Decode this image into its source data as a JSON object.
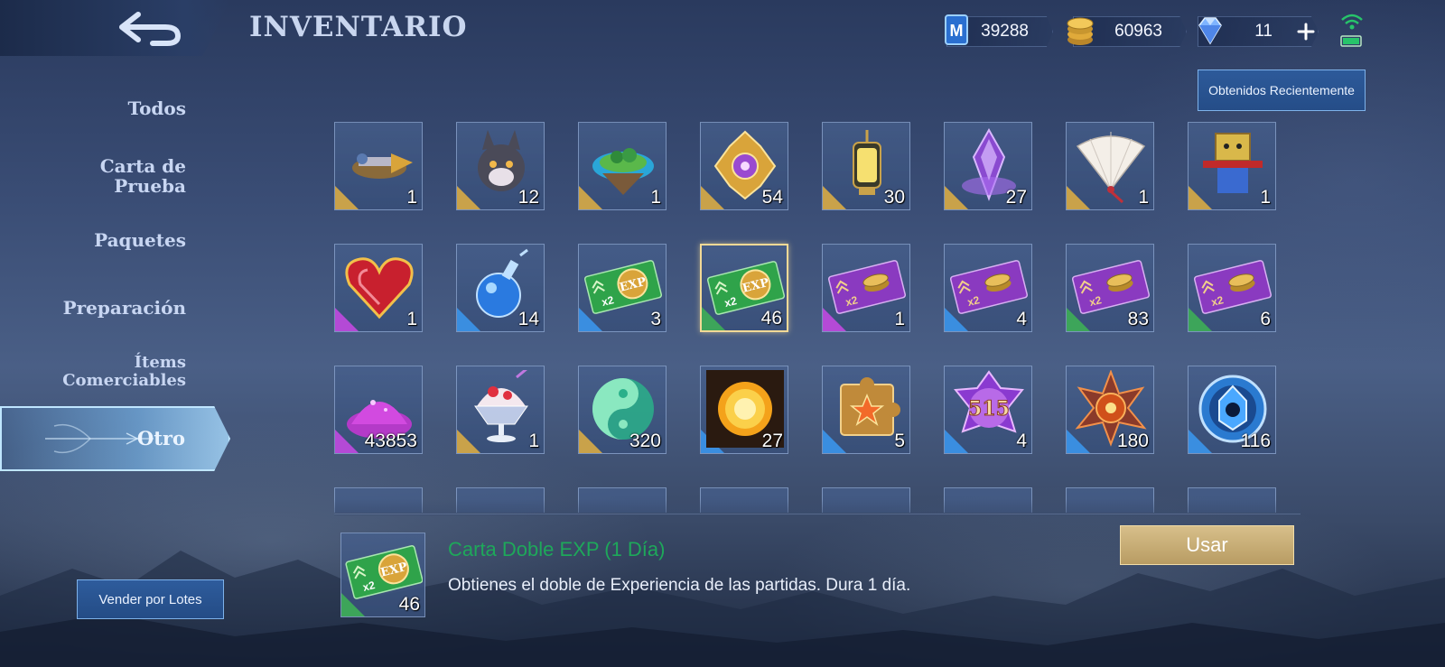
{
  "header": {
    "title": "INVENTARIO",
    "back_icon": "back-arrow-icon"
  },
  "currencies": [
    {
      "name": "battle-points",
      "icon": "bp-card-icon",
      "value": "39288"
    },
    {
      "name": "tickets",
      "icon": "gold-coins-icon",
      "value": "60963"
    },
    {
      "name": "diamonds",
      "icon": "diamond-icon",
      "value": "11",
      "add_icon": "plus-icon"
    }
  ],
  "status": {
    "signal_icon": "wifi-signal-icon",
    "battery_icon": "battery-icon"
  },
  "recent_button": "Obtenidos Recientemente",
  "sidebar": {
    "items": [
      {
        "label": "Todos"
      },
      {
        "label": "Carta de Prueba"
      },
      {
        "label": "Paquetes"
      },
      {
        "label": "Preparación"
      },
      {
        "label": "Ítems Comerciables"
      },
      {
        "label": "Otro",
        "active": true
      }
    ],
    "sell_button": "Vender por Lotes"
  },
  "grid": {
    "rows": [
      [
        {
          "icon": "airship-icon",
          "qty": "1",
          "rarity_color": "#c9a24a"
        },
        {
          "icon": "wolf-pet-icon",
          "qty": "12",
          "rarity_color": "#c9a24a"
        },
        {
          "icon": "floating-island-icon",
          "qty": "1",
          "rarity_color": "#c9a24a"
        },
        {
          "icon": "golden-emblem-icon",
          "qty": "54",
          "rarity_color": "#c9a24a"
        },
        {
          "icon": "lantern-icon",
          "qty": "30",
          "rarity_color": "#c9a24a"
        },
        {
          "icon": "purple-crystal-icon",
          "qty": "27",
          "rarity_color": "#c9a24a"
        },
        {
          "icon": "paper-fan-icon",
          "qty": "1",
          "rarity_color": "#c9a24a"
        },
        {
          "icon": "box-figure-icon",
          "qty": "1",
          "rarity_color": "#c9a24a"
        }
      ],
      [
        {
          "icon": "heart-icon",
          "qty": "1",
          "rarity_color": "#b44ad6"
        },
        {
          "icon": "potion-icon",
          "qty": "14",
          "rarity_color": "#3a8ee0"
        },
        {
          "icon": "exp-card-icon",
          "qty": "3",
          "rarity_color": "#3a8ee0"
        },
        {
          "icon": "exp-card-icon",
          "qty": "46",
          "rarity_color": "#3da55a",
          "selected": true
        },
        {
          "icon": "bp-double-card-icon",
          "qty": "1",
          "rarity_color": "#b44ad6"
        },
        {
          "icon": "bp-double-card-icon",
          "qty": "4",
          "rarity_color": "#3a8ee0"
        },
        {
          "icon": "bp-double-card-icon",
          "qty": "83",
          "rarity_color": "#3da55a"
        },
        {
          "icon": "bp-double-card-icon",
          "qty": "6",
          "rarity_color": "#3da55a"
        }
      ],
      [
        {
          "icon": "magic-dust-icon",
          "qty": "43853",
          "rarity_color": "#b44ad6"
        },
        {
          "icon": "shaved-ice-icon",
          "qty": "1",
          "rarity_color": "#c9a24a"
        },
        {
          "icon": "yin-yang-icon",
          "qty": "320",
          "rarity_color": "#c9a24a"
        },
        {
          "icon": "sun-icon",
          "qty": "27",
          "rarity_color": "#3a8ee0"
        },
        {
          "icon": "puzzle-star-icon",
          "qty": "5",
          "rarity_color": "#3a8ee0"
        },
        {
          "icon": "515-badge-icon",
          "qty": "4",
          "rarity_color": "#3a8ee0",
          "badge_text": "515"
        },
        {
          "icon": "fire-emblem-icon",
          "qty": "180",
          "rarity_color": "#3a8ee0"
        },
        {
          "icon": "blue-emblem-icon",
          "qty": "116",
          "rarity_color": "#3a8ee0"
        }
      ]
    ]
  },
  "detail": {
    "icon": "exp-card-icon",
    "qty": "46",
    "name": "Carta Doble EXP (1 Día)",
    "description": "Obtienes el doble de Experiencia de las partidas. Dura 1 día.",
    "use_button": "Usar",
    "exp_badge": "EXP",
    "multiplier": "x2"
  }
}
